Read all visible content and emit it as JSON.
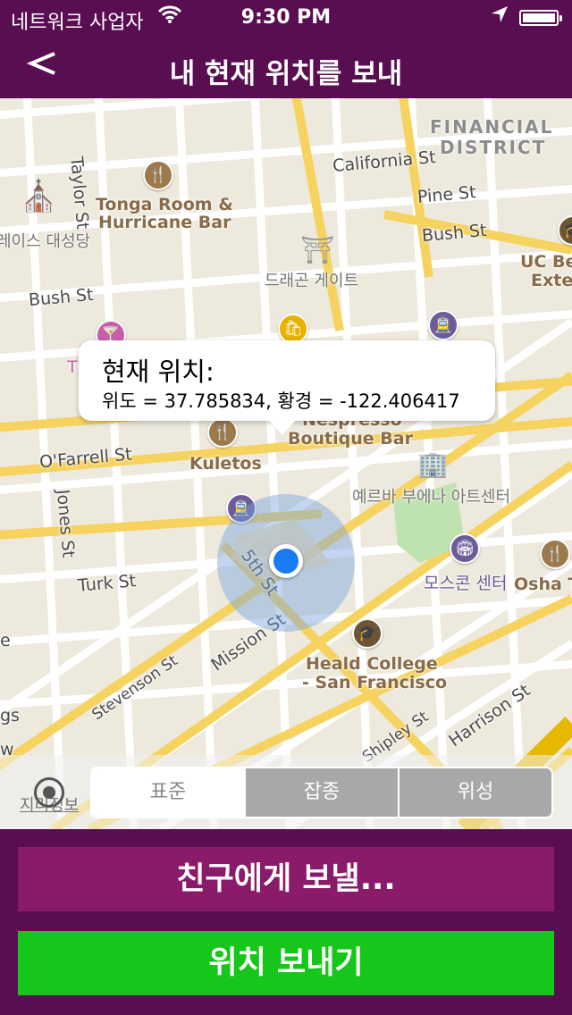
{
  "status_bar": {
    "carrier": "네트워크 사업자",
    "wifi_icon": "wifi-icon",
    "time": "9:30 PM",
    "location_icon": "location-arrow-icon",
    "battery_icon": "battery-icon"
  },
  "nav": {
    "back_icon": "back-arrow-icon",
    "title": "내 현재 위치를 보내"
  },
  "map": {
    "labels": {
      "financial_1": "FINANCIAL",
      "financial_2": "DISTRICT",
      "california": "California St",
      "pine": "Pine St",
      "bush_right": "Bush St",
      "bush_left": "Bush St",
      "taylor": "Taylor St",
      "tonga_1": "Tonga Room &",
      "tonga_2": "Hurricane Bar",
      "grace": "레이스 대성당",
      "dragon": "드래곤 게이트",
      "ucb_1": "UC Be",
      "ucb_2": "Exte",
      "ofarrell": "O'Farrell St",
      "kuletos": "Kuletos",
      "nespresso_1": "Nespresso",
      "nespresso_2": "Boutique Bar",
      "jones": "Jones St",
      "yerba": "예르바 부에나 아트센터",
      "turk": "Turk St",
      "fifth": "5th St",
      "moscone": "모스콘 센터",
      "osha": "Osha Ta",
      "mission": "Mission St",
      "heald_1": "Heald College",
      "heald_2": "- San Francisco",
      "stevenson": "Stevenson St",
      "shipley": "Shipley St",
      "harrison": "Harrison St",
      "gs": "gs",
      "w": "w",
      "e": "e",
      "the": "The"
    },
    "callout": {
      "title": "현재 위치:",
      "coords": "위도 = 37.785834, 황경 = -122.406417"
    },
    "legal": "지리정보"
  },
  "map_toolbar": {
    "tracking_icon": "user-tracking-icon",
    "segments": [
      "표준",
      "잡종",
      "위성"
    ],
    "selected": "표준"
  },
  "buttons": {
    "send_to_friend": "친구에게 보낼...",
    "send_location": "위치 보내기"
  },
  "colors": {
    "header": "#5a0e52",
    "friend_button": "#8a1b6a",
    "send_button": "#16c61a",
    "user_dot": "#1a7cf2"
  }
}
